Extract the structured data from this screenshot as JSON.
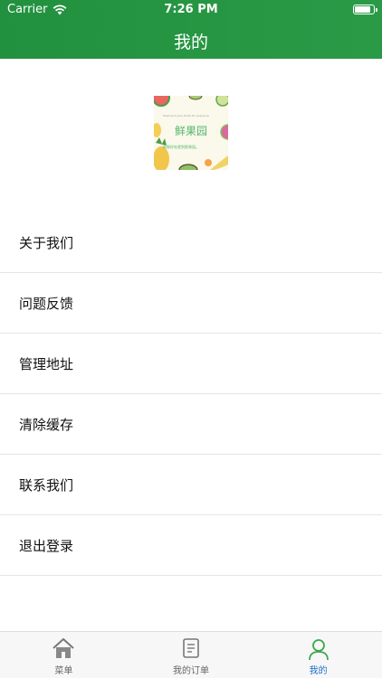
{
  "status_bar": {
    "carrier": "Carrier",
    "time": "7:26 PM",
    "battery_level": 0.9
  },
  "nav": {
    "title": "我的"
  },
  "logo": {
    "name": "鲜果园",
    "tagline": "fresh and juicy fruits for everyone",
    "slogan": "新鲜好吃就到鲜果园。"
  },
  "menu": {
    "items": [
      {
        "label": "关于我们"
      },
      {
        "label": "问题反馈"
      },
      {
        "label": "管理地址"
      },
      {
        "label": "清除缓存"
      },
      {
        "label": "联系我们"
      },
      {
        "label": "退出登录"
      }
    ]
  },
  "tabbar": {
    "items": [
      {
        "label": "菜单",
        "icon": "home-icon"
      },
      {
        "label": "我的订单",
        "icon": "order-icon"
      },
      {
        "label": "我的",
        "icon": "profile-icon",
        "active": true
      }
    ]
  },
  "colors": {
    "header": "#27963f",
    "active_tab": "#1b6fc9",
    "logo_text": "#55b86b"
  }
}
